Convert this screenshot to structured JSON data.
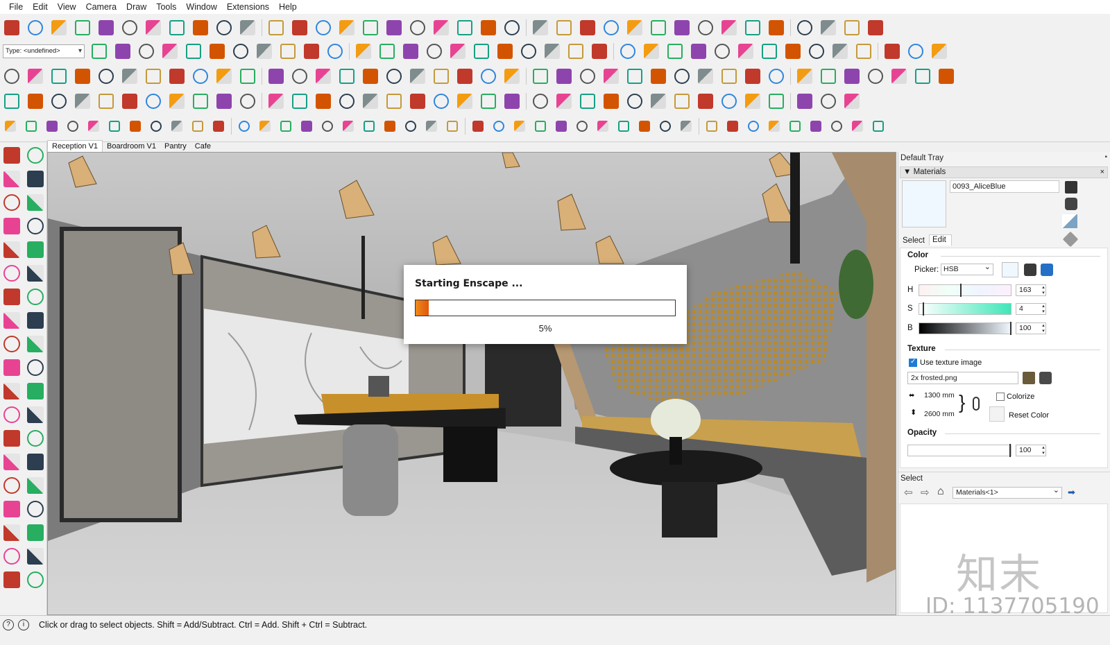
{
  "menu": [
    "File",
    "Edit",
    "View",
    "Camera",
    "Draw",
    "Tools",
    "Window",
    "Extensions",
    "Help"
  ],
  "toolbar": {
    "type_field": "Type: <undefined>",
    "row1_count": 46,
    "row2_count": 52,
    "row3_count": 50,
    "row4_count": 42,
    "row5_count": 44
  },
  "scenes": [
    "Reception V1",
    "Boardroom V1",
    "Pantry",
    "Cafe"
  ],
  "enscape": {
    "title": "Starting Enscape ...",
    "progress_label": "5%",
    "progress_percent": 5
  },
  "tray": {
    "title": "Default Tray",
    "pin": "▪",
    "materials_header": "▼ Materials",
    "close": "×",
    "material_name": "0093_AliceBlue",
    "tab_select": "Select",
    "tab_edit": "Edit",
    "color_section": "Color",
    "picker_label": "Picker:",
    "picker_value": "HSB",
    "h_label": "H",
    "h_value": "163",
    "s_label": "S",
    "s_value": "4",
    "b_label": "B",
    "b_value": "100",
    "texture_section": "Texture",
    "use_texture_label": "Use texture image",
    "texture_file": "2x frosted.png",
    "width_value": "1300 mm",
    "height_value": "2600 mm",
    "colorize_label": "Colorize",
    "reset_color_label": "Reset Color",
    "opacity_section": "Opacity",
    "opacity_value": "100",
    "select_section": "Select",
    "select_dropdown": "Materials<1>"
  },
  "status": {
    "text": "Click or drag to select objects. Shift = Add/Subtract. Ctrl = Add. Shift + Ctrl = Subtract.",
    "icon1": "?",
    "icon2": "i"
  },
  "watermark": {
    "logo": "知末",
    "id": "ID: 1137705190"
  },
  "colors": {
    "accent_orange": "#e8730f",
    "material_swatch": "#f0f8ff",
    "saturation_slider": "#3fe6b8"
  }
}
